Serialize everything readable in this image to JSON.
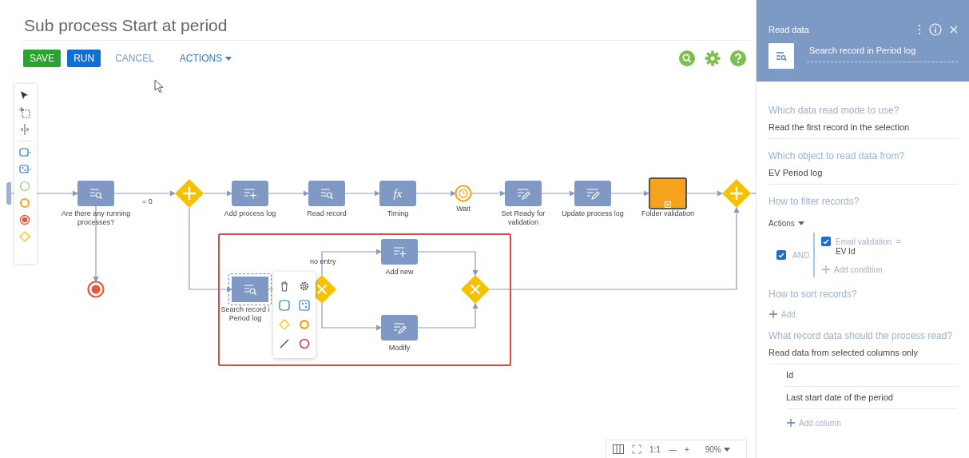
{
  "title": "Sub process Start at period",
  "toolbar": {
    "buttons": [
      {
        "label": "SAVE",
        "kind": "success"
      },
      {
        "label": "RUN",
        "kind": "primary"
      },
      {
        "label": "CANCEL",
        "kind": "link"
      },
      {
        "label": "ACTIONS",
        "kind": "menu"
      }
    ]
  },
  "diagram": {
    "nodes": [
      {
        "kind": "read-task",
        "label": "Are there any running processes?",
        "selected": false
      },
      {
        "kind": "parallel-gateway",
        "selected": false
      },
      {
        "kind": "add-task",
        "label": "Add process log",
        "selected": false
      },
      {
        "kind": "read-task",
        "label": "Read record",
        "selected": false
      },
      {
        "kind": "formula-task",
        "symbol": "fx",
        "label": "Timing",
        "selected": false
      },
      {
        "kind": "timer-event",
        "label": "Wait",
        "selected": false
      },
      {
        "kind": "modify-task",
        "label": "Set Ready for validation",
        "selected": false
      },
      {
        "kind": "modify-task",
        "label": "Update process log",
        "selected": false
      },
      {
        "kind": "subprocess",
        "label": "Folder validation",
        "selected": false
      },
      {
        "kind": "parallel-gateway",
        "selected": false
      },
      {
        "kind": "end-event",
        "selected": false
      },
      {
        "kind": "read-task",
        "label": "Search record i Period log",
        "selected": true
      },
      {
        "kind": "exclusive-gateway",
        "selected": false
      },
      {
        "kind": "add-task",
        "label": "Add new",
        "selected": false
      },
      {
        "kind": "modify-task",
        "label": "Modify",
        "selected": false
      },
      {
        "kind": "exclusive-gateway",
        "selected": false
      }
    ],
    "flow_labels": [
      {
        "text": "= 0"
      },
      {
        "text": "no entry"
      }
    ]
  },
  "zoom_bar": {
    "actual_size": "1:1",
    "zoom_out": "—",
    "zoom_in": "+",
    "zoom": "90%"
  },
  "panel": {
    "title": "Read data",
    "element_name": "Search record in Period log",
    "read_mode": {
      "label": "Which data read mode to use?",
      "value": "Read the first record in the selection"
    },
    "object": {
      "label": "Which object to read data from?",
      "value": "EV Period log"
    },
    "filter": {
      "label": "How to filter records?",
      "actions": "Actions",
      "group": {
        "operator": "AND",
        "checked": true,
        "conditions": [
          {
            "column": "Email validation",
            "operator": "=",
            "value": "EV Id",
            "checked": true
          }
        ],
        "add_label": "Add condition"
      }
    },
    "sort": {
      "label": "How to sort records?",
      "add_label": "Add"
    },
    "columns": {
      "label": "What record data should the process read?",
      "value": "Read data from selected columns only",
      "items": [
        "Id",
        "Last start date of the period"
      ],
      "add_label": "Add column"
    }
  }
}
